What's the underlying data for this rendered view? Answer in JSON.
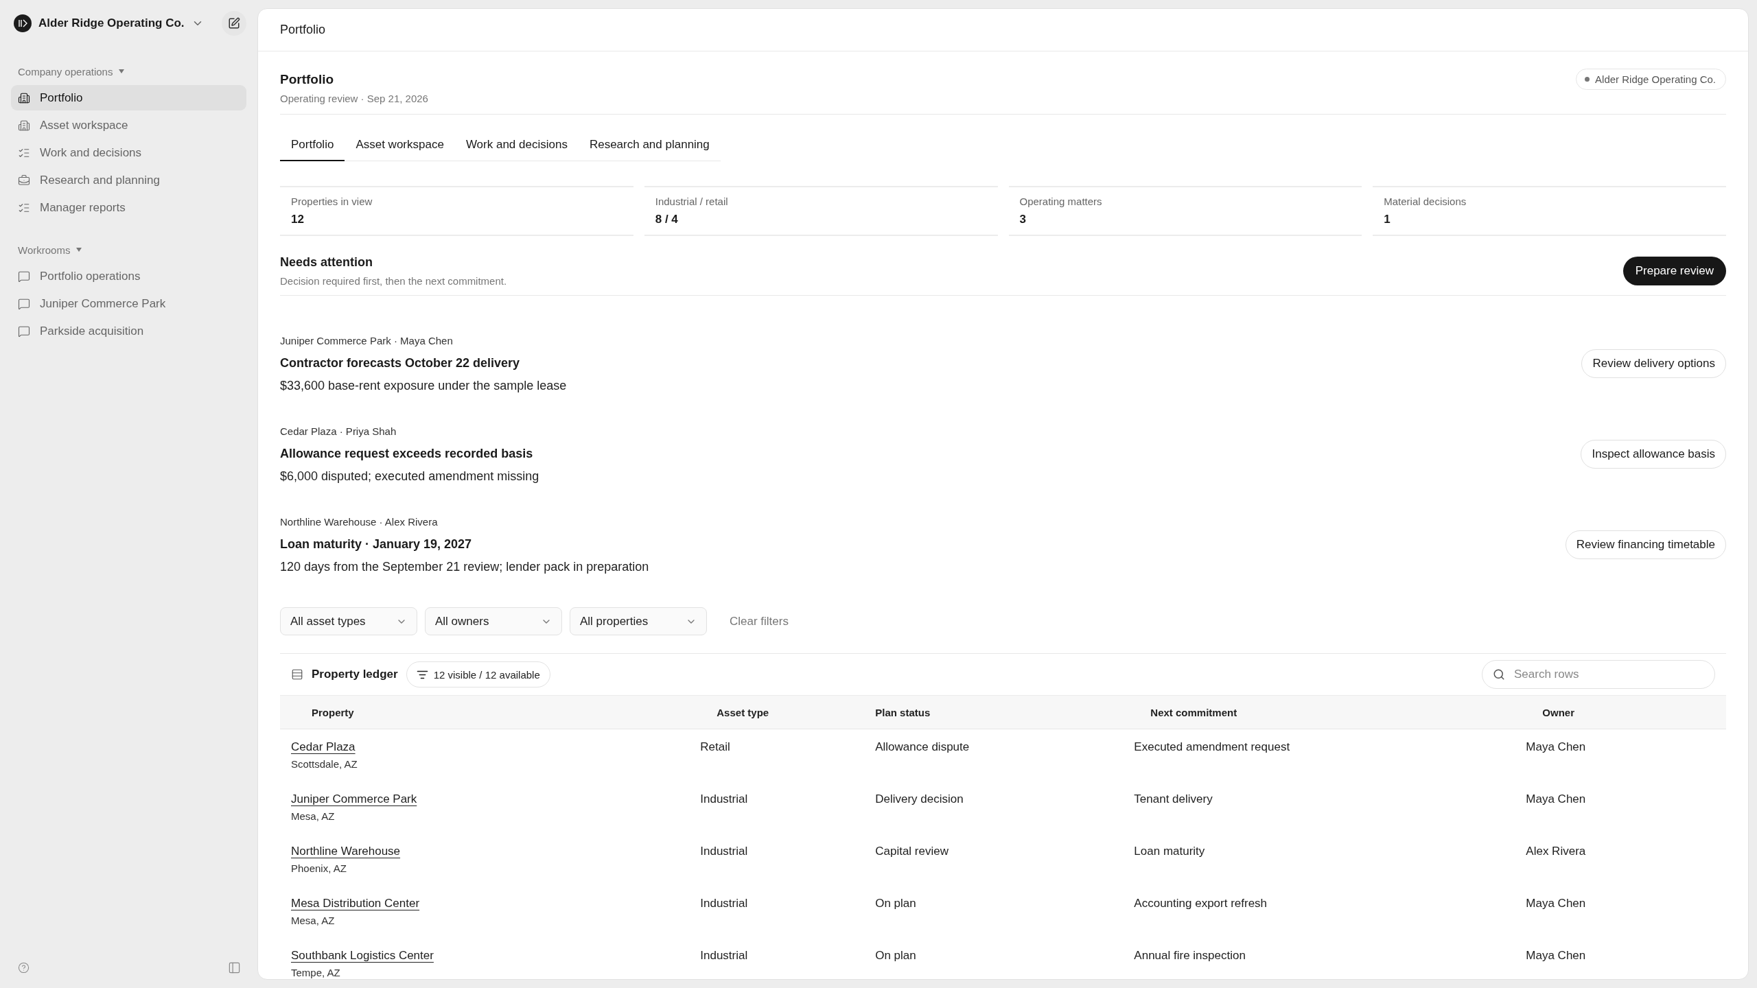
{
  "workspace": {
    "name": "Alder Ridge Operating Co."
  },
  "sidebar": {
    "sections": [
      {
        "title": "Company operations",
        "expanded": true,
        "items": [
          {
            "label": "Portfolio",
            "selected": true
          },
          {
            "label": "Asset workspace",
            "selected": false
          },
          {
            "label": "Work and decisions",
            "selected": false
          },
          {
            "label": "Research and planning",
            "selected": false
          },
          {
            "label": "Manager reports",
            "selected": false
          }
        ]
      },
      {
        "title": "Workrooms",
        "expanded": true,
        "items": [
          {
            "label": "Portfolio operations",
            "selected": false
          },
          {
            "label": "Juniper Commerce Park",
            "selected": false
          },
          {
            "label": "Parkside acquisition",
            "selected": false
          }
        ]
      }
    ]
  },
  "header": {
    "title": "Portfolio"
  },
  "page": {
    "title": "Portfolio",
    "subtitle": "Operating review · Sep 21, 2026",
    "badge": "Alder Ridge Operating Co."
  },
  "tabs": [
    {
      "label": "Portfolio",
      "selected": true
    },
    {
      "label": "Asset workspace",
      "selected": false
    },
    {
      "label": "Work and decisions",
      "selected": false
    },
    {
      "label": "Research and planning",
      "selected": false
    }
  ],
  "stats": [
    {
      "label": "Properties in view",
      "value": "12"
    },
    {
      "label": "Industrial / retail",
      "value": "8 / 4"
    },
    {
      "label": "Operating matters",
      "value": "3"
    },
    {
      "label": "Material decisions",
      "value": "1"
    }
  ],
  "attention": {
    "title": "Needs attention",
    "subtitle": "Decision required first, then the next commitment.",
    "action": "Prepare review",
    "items": [
      {
        "meta": "Juniper Commerce Park · Maya Chen",
        "title": "Contractor forecasts October 22 delivery",
        "detail": "$33,600 base-rent exposure under the sample lease",
        "action": "Review delivery options"
      },
      {
        "meta": "Cedar Plaza · Priya Shah",
        "title": "Allowance request exceeds recorded basis",
        "detail": "$6,000 disputed; executed amendment missing",
        "action": "Inspect allowance basis"
      },
      {
        "meta": "Northline Warehouse · Alex Rivera",
        "title": "Loan maturity · January 19, 2027",
        "detail": "120 days from the September 21 review; lender pack in preparation",
        "action": "Review financing timetable"
      }
    ]
  },
  "filters": {
    "selects": [
      "All asset types",
      "All owners",
      "All properties"
    ],
    "clear": "Clear filters"
  },
  "ledger": {
    "title": "Property ledger",
    "count": "12 visible / 12 available",
    "search_placeholder": "Search rows",
    "columns": [
      "Property",
      "Asset type",
      "Plan status",
      "Next commitment",
      "Owner"
    ],
    "rows": [
      {
        "property": "Cedar Plaza",
        "location": "Scottsdale, AZ",
        "asset_type": "Retail",
        "plan_status": "Allowance dispute",
        "next_commitment": "Executed amendment request",
        "owner": "Maya Chen"
      },
      {
        "property": "Juniper Commerce Park",
        "location": "Mesa, AZ",
        "asset_type": "Industrial",
        "plan_status": "Delivery decision",
        "next_commitment": "Tenant delivery",
        "owner": "Maya Chen"
      },
      {
        "property": "Northline Warehouse",
        "location": "Phoenix, AZ",
        "asset_type": "Industrial",
        "plan_status": "Capital review",
        "next_commitment": "Loan maturity",
        "owner": "Alex Rivera"
      },
      {
        "property": "Mesa Distribution Center",
        "location": "Mesa, AZ",
        "asset_type": "Industrial",
        "plan_status": "On plan",
        "next_commitment": "Accounting export refresh",
        "owner": "Maya Chen"
      },
      {
        "property": "Southbank Logistics Center",
        "location": "Tempe, AZ",
        "asset_type": "Industrial",
        "plan_status": "On plan",
        "next_commitment": "Annual fire inspection",
        "owner": "Maya Chen"
      }
    ]
  }
}
